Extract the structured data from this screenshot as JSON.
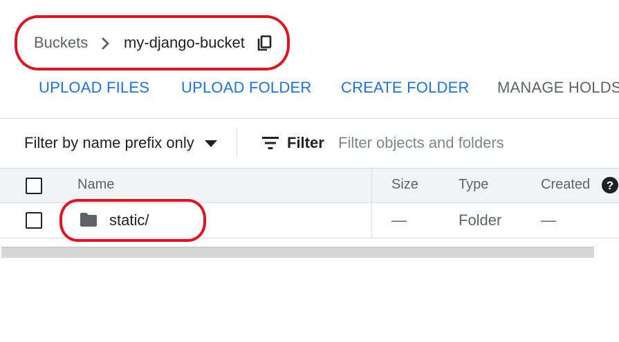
{
  "breadcrumb": {
    "root": "Buckets",
    "current": "my-django-bucket",
    "separator_icon": "chevron-right-icon",
    "copy_icon": "copy-icon"
  },
  "actions": {
    "upload_files": "UPLOAD FILES",
    "upload_folder": "UPLOAD FOLDER",
    "create_folder": "CREATE FOLDER",
    "manage_holds": "MANAGE HOLDS"
  },
  "filter": {
    "mode_selected": "Filter by name prefix only",
    "label": "Filter",
    "placeholder": "Filter objects and folders",
    "value": ""
  },
  "table": {
    "columns": {
      "name": "Name",
      "size": "Size",
      "type": "Type",
      "created": "Created"
    },
    "rows": [
      {
        "name": "static/",
        "size": "—",
        "type": "Folder",
        "created": "—",
        "icon": "folder-icon"
      }
    ]
  },
  "colors": {
    "accent": "#1a73e8",
    "annotation": "#e0141e",
    "muted_text": "#5f6368"
  }
}
